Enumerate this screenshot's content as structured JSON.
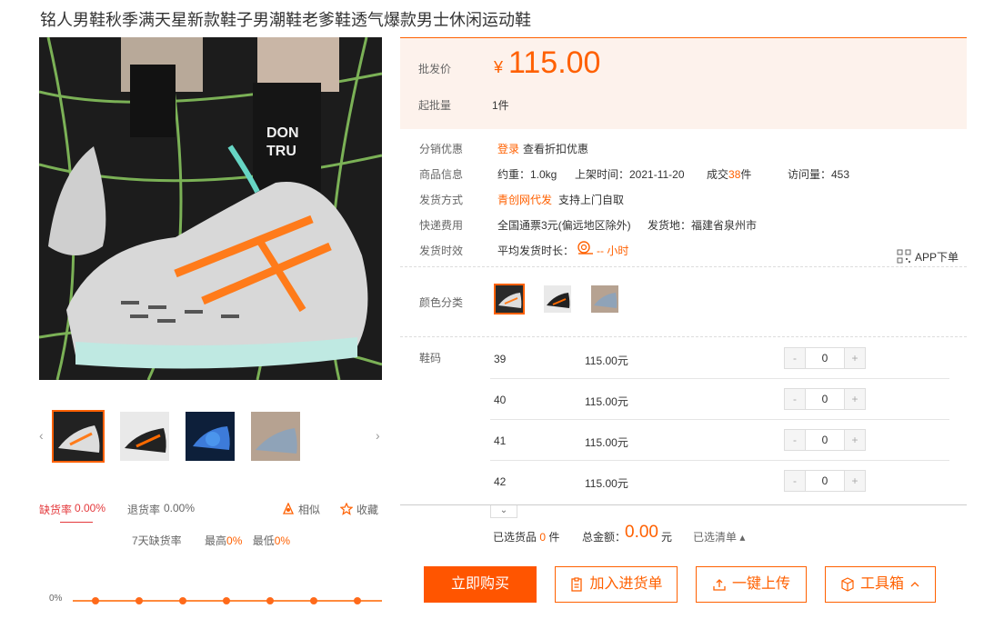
{
  "product": {
    "title": "铭人男鞋秋季满天星新款鞋子男潮鞋老爹鞋透气爆款男士休闲运动鞋"
  },
  "gallery": {
    "prev_arrow": "‹",
    "next_arrow": "›",
    "main_image_alt": "shoe-photo",
    "thumbs": [
      "thumb-1",
      "thumb-2",
      "thumb-3",
      "thumb-4"
    ]
  },
  "stats": {
    "shortage_label": "缺货率",
    "shortage_value": "0.00%",
    "return_label": "退货率",
    "return_value": "0.00%",
    "similar_label": "相似",
    "favorite_label": "收藏",
    "seven_day_label": "7天缺货率",
    "max_label": "最高",
    "max_value": "0%",
    "min_label": "最低",
    "min_value": "0%",
    "spark_axis_label": "0%",
    "spark_points": [
      0,
      0,
      0,
      0,
      0,
      0,
      0
    ]
  },
  "price": {
    "label": "批发价",
    "currency": "¥",
    "amount": "115.00",
    "moq_label": "起批量",
    "moq_value": "1件"
  },
  "info": {
    "discount_label": "分销优惠",
    "login_link": "登录",
    "discount_text": "查看折扣优惠",
    "goods_label": "商品信息",
    "weight": "约重：1.0kg",
    "listed": "上架时间：2021-11-20",
    "deals_prefix": "成交",
    "deals_count": "38",
    "deals_suffix": "件",
    "views": "访问量：453",
    "shipping_label": "发货方式",
    "shipping_provider": "青创网代发",
    "shipping_pickup": "支持上门自取",
    "fee_label": "快递费用",
    "fee_value": "全国通票3元(偏远地区除外)",
    "ship_from": "发货地：福建省泉州市",
    "time_label": "发货时效",
    "avg_time_label": "平均发货时长：",
    "avg_time_value": "-- 小时",
    "app_label": "APP下单"
  },
  "colors": {
    "label": "颜色分类",
    "options": [
      "color-white",
      "color-black",
      "color-grey"
    ]
  },
  "sizes": {
    "label": "鞋码",
    "rows": [
      {
        "size": "39",
        "price": "115.00元",
        "qty": "0"
      },
      {
        "size": "40",
        "price": "115.00元",
        "qty": "0"
      },
      {
        "size": "41",
        "price": "115.00元",
        "qty": "0"
      },
      {
        "size": "42",
        "price": "115.00元",
        "qty": "0"
      }
    ],
    "minus": "-",
    "plus": "+"
  },
  "summary": {
    "collapse_icon": "⌄",
    "selected_label": "已选货品",
    "selected_count": "0",
    "selected_unit": "件",
    "total_label": "总金额：",
    "total_value": "0.00",
    "total_unit": "元",
    "cleared_label": "已选清单 ▴"
  },
  "actions": {
    "buy_now": "立即购买",
    "add_list": "加入进货单",
    "upload": "一键上传",
    "toolbox": "工具箱"
  },
  "colors_theme": {
    "accent": "#ff6000",
    "price_bg": "#fdf2ec",
    "danger": "#e4393c"
  }
}
